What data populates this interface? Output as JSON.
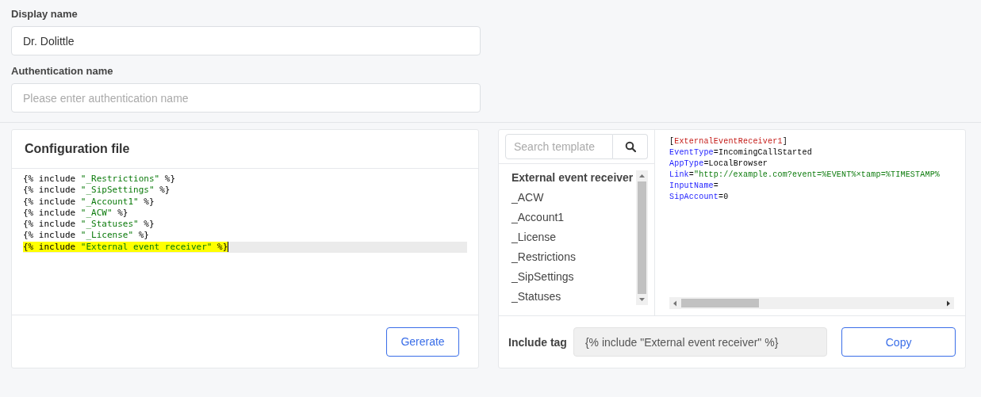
{
  "fields": [
    {
      "label": "Display name",
      "value": "Dr. Dolittle"
    },
    {
      "label": "Authentication name",
      "placeholder": "Please enter authentication name"
    }
  ],
  "config_card": {
    "title": "Configuration file",
    "lines": [
      {
        "highlighted": false,
        "segments": [
          {
            "kind": "plain",
            "text": "{% include "
          },
          {
            "kind": "string",
            "text": "\"_Restrictions\""
          },
          {
            "kind": "plain",
            "text": " %}"
          }
        ]
      },
      {
        "highlighted": false,
        "segments": [
          {
            "kind": "plain",
            "text": "{% include "
          },
          {
            "kind": "string",
            "text": "\"_SipSettings\""
          },
          {
            "kind": "plain",
            "text": " %}"
          }
        ]
      },
      {
        "highlighted": false,
        "segments": [
          {
            "kind": "plain",
            "text": "{% include "
          },
          {
            "kind": "string",
            "text": "\"_Account1\""
          },
          {
            "kind": "plain",
            "text": " %}"
          }
        ]
      },
      {
        "highlighted": false,
        "segments": [
          {
            "kind": "plain",
            "text": "{% include "
          },
          {
            "kind": "string",
            "text": "\"_ACW\""
          },
          {
            "kind": "plain",
            "text": " %}"
          }
        ]
      },
      {
        "highlighted": false,
        "segments": [
          {
            "kind": "plain",
            "text": "{% include "
          },
          {
            "kind": "string",
            "text": "\"_Statuses\""
          },
          {
            "kind": "plain",
            "text": " %}"
          }
        ]
      },
      {
        "highlighted": false,
        "segments": [
          {
            "kind": "plain",
            "text": "{% include "
          },
          {
            "kind": "string",
            "text": "\"_License\""
          },
          {
            "kind": "plain",
            "text": " %}"
          }
        ]
      },
      {
        "highlighted": true,
        "segments": [
          {
            "kind": "plain",
            "text": "{% include "
          },
          {
            "kind": "string",
            "text": "\"External event receiver\""
          },
          {
            "kind": "plain",
            "text": " %}"
          }
        ]
      }
    ],
    "button": "Gererate"
  },
  "template_card": {
    "search": {
      "placeholder": "Search template"
    },
    "templates": [
      {
        "label": "External event receiver",
        "selected": true
      },
      {
        "label": "_ACW",
        "selected": false
      },
      {
        "label": "_Account1",
        "selected": false
      },
      {
        "label": "_License",
        "selected": false
      },
      {
        "label": "_Restrictions",
        "selected": false
      },
      {
        "label": "_SipSettings",
        "selected": false
      },
      {
        "label": "_Statuses",
        "selected": false
      }
    ],
    "code_lines": [
      {
        "segments": [
          {
            "kind": "plain",
            "text": "["
          },
          {
            "kind": "section",
            "text": "ExternalEventReceiver1"
          },
          {
            "kind": "plain",
            "text": "]"
          }
        ]
      },
      {
        "segments": [
          {
            "kind": "key",
            "text": "EventType"
          },
          {
            "kind": "plain",
            "text": "=IncomingCallStarted"
          }
        ]
      },
      {
        "segments": [
          {
            "kind": "key",
            "text": "AppType"
          },
          {
            "kind": "plain",
            "text": "=LocalBrowser"
          }
        ]
      },
      {
        "segments": [
          {
            "kind": "key",
            "text": "Link"
          },
          {
            "kind": "plain",
            "text": "="
          },
          {
            "kind": "string",
            "text": "\"http://example.com?event=%EVENT%×tamp=%TIMESTAMP%"
          }
        ]
      },
      {
        "segments": [
          {
            "kind": "key",
            "text": "InputName"
          },
          {
            "kind": "plain",
            "text": "="
          }
        ]
      },
      {
        "segments": [
          {
            "kind": "key",
            "text": "SipAccount"
          },
          {
            "kind": "plain",
            "text": "=0"
          }
        ]
      }
    ],
    "include_tag": {
      "label": "Include tag",
      "value": "{% include \"External event receiver\" %}"
    },
    "button": "Copy"
  }
}
